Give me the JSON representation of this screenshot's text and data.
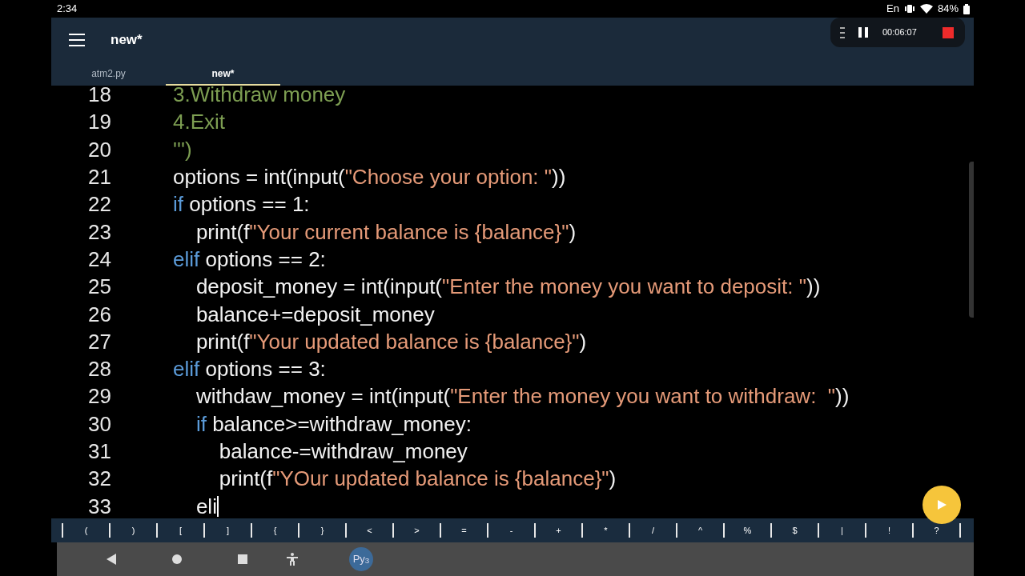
{
  "status_bar": {
    "time": "2:34",
    "language": "En",
    "battery": "84%"
  },
  "recorder": {
    "elapsed": "00:06:07"
  },
  "toolbar": {
    "title": "new*"
  },
  "tabs": [
    {
      "label": "atm2.py",
      "selected": false
    },
    {
      "label": "new*",
      "selected": true
    }
  ],
  "editor": {
    "lines": [
      {
        "number": "18",
        "tokens": [
          {
            "kind": "docstring",
            "text": "3.Withdraw money"
          }
        ]
      },
      {
        "number": "19",
        "tokens": [
          {
            "kind": "docstring",
            "text": "4.Exit"
          }
        ]
      },
      {
        "number": "20",
        "tokens": [
          {
            "kind": "docstring",
            "text": "''')"
          }
        ]
      },
      {
        "number": "21",
        "tokens": [
          {
            "kind": "plain",
            "text": "options = int(input("
          },
          {
            "kind": "string",
            "text": "\"Choose your option: \""
          },
          {
            "kind": "plain",
            "text": "))"
          }
        ]
      },
      {
        "number": "22",
        "tokens": [
          {
            "kind": "keyword",
            "text": "if"
          },
          {
            "kind": "plain",
            "text": " options == 1:"
          }
        ]
      },
      {
        "number": "23",
        "tokens": [
          {
            "kind": "plain",
            "text": "    print(f"
          },
          {
            "kind": "string",
            "text": "\"Your current balance is {balance}\""
          },
          {
            "kind": "plain",
            "text": ")"
          }
        ]
      },
      {
        "number": "24",
        "tokens": [
          {
            "kind": "keyword",
            "text": "elif"
          },
          {
            "kind": "plain",
            "text": " options == 2:"
          }
        ]
      },
      {
        "number": "25",
        "tokens": [
          {
            "kind": "plain",
            "text": "    deposit_money = int(input("
          },
          {
            "kind": "string",
            "text": "\"Enter the money you want to deposit: \""
          },
          {
            "kind": "plain",
            "text": "))"
          }
        ]
      },
      {
        "number": "26",
        "tokens": [
          {
            "kind": "plain",
            "text": "    balance+=deposit_money"
          }
        ]
      },
      {
        "number": "27",
        "tokens": [
          {
            "kind": "plain",
            "text": "    print(f"
          },
          {
            "kind": "string",
            "text": "\"Your updated balance is {balance}\""
          },
          {
            "kind": "plain",
            "text": ")"
          }
        ]
      },
      {
        "number": "28",
        "tokens": [
          {
            "kind": "keyword",
            "text": "elif"
          },
          {
            "kind": "plain",
            "text": " options == 3:"
          }
        ]
      },
      {
        "number": "29",
        "tokens": [
          {
            "kind": "plain",
            "text": "    withdaw_money = int(input("
          },
          {
            "kind": "string",
            "text": "\"Enter the money you want to withdraw:  \""
          },
          {
            "kind": "plain",
            "text": "))"
          }
        ]
      },
      {
        "number": "30",
        "tokens": [
          {
            "kind": "keyword",
            "text": "    if"
          },
          {
            "kind": "plain",
            "text": " balance>=withdraw_money:"
          }
        ]
      },
      {
        "number": "31",
        "tokens": [
          {
            "kind": "plain",
            "text": "        balance-=withdraw_money"
          }
        ]
      },
      {
        "number": "32",
        "tokens": [
          {
            "kind": "plain",
            "text": "        print(f"
          },
          {
            "kind": "string",
            "text": "\"YOur updated balance is {balance}\""
          },
          {
            "kind": "plain",
            "text": ")"
          }
        ]
      },
      {
        "number": "33",
        "tokens": [
          {
            "kind": "plain",
            "text": "    eli"
          }
        ],
        "cursor": true
      }
    ]
  },
  "symbol_keys": [
    "(",
    ")",
    "[",
    "]",
    "{",
    "}",
    "<",
    ">",
    "=",
    "-",
    "+",
    "*",
    "/",
    "^",
    "%",
    "$",
    "|",
    "!",
    "?"
  ],
  "launcher": {
    "label": "Py$_{3}$"
  }
}
